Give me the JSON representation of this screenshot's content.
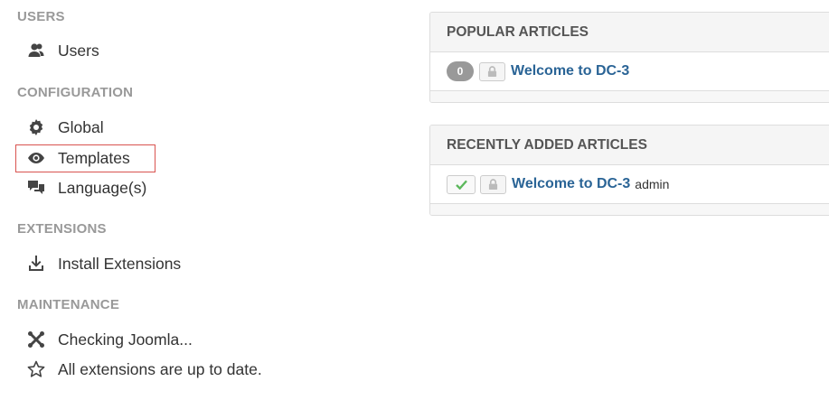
{
  "sidebar": {
    "users_heading": "USERS",
    "users_items": [
      {
        "label": "Users",
        "icon": "users-icon"
      }
    ],
    "configuration_heading": "CONFIGURATION",
    "configuration_items": [
      {
        "label": "Global",
        "icon": "gear-icon"
      },
      {
        "label": "Templates",
        "icon": "eye-icon"
      },
      {
        "label": "Language(s)",
        "icon": "comments-icon"
      }
    ],
    "extensions_heading": "EXTENSIONS",
    "extensions_items": [
      {
        "label": "Install Extensions",
        "icon": "download-icon"
      }
    ],
    "maintenance_heading": "MAINTENANCE",
    "maintenance_items": [
      {
        "label": "Checking Joomla...",
        "icon": "joomla-icon"
      },
      {
        "label": "All extensions are up to date.",
        "icon": "star-icon"
      }
    ]
  },
  "popular": {
    "title": "POPULAR ARTICLES",
    "rows": [
      {
        "hits": "0",
        "title": "Welcome to DC-3"
      }
    ]
  },
  "recent": {
    "title": "RECENTLY ADDED ARTICLES",
    "rows": [
      {
        "title": "Welcome to DC-3",
        "author": "admin"
      }
    ]
  },
  "colors": {
    "link": "#2a6496",
    "heading_gray": "#999999",
    "highlight_border": "#d9534f",
    "check_green": "#5cb85c"
  }
}
